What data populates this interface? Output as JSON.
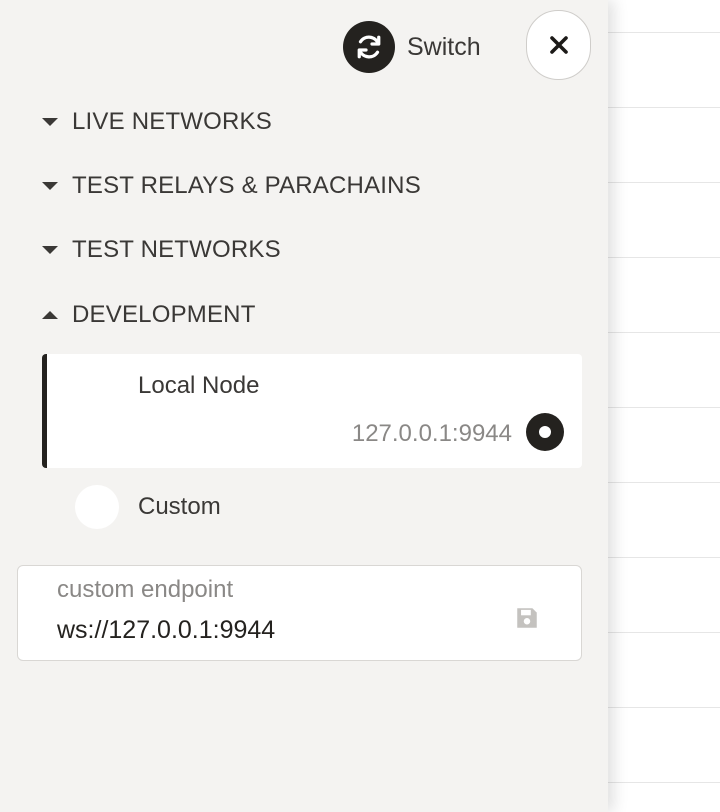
{
  "header": {
    "switch_label": "Switch",
    "switch_icon": "refresh-icon",
    "close_icon": "close-icon"
  },
  "groups": [
    {
      "label": "LIVE NETWORKS",
      "expanded": false
    },
    {
      "label": "TEST RELAYS & PARACHAINS",
      "expanded": false
    },
    {
      "label": "TEST NETWORKS",
      "expanded": false
    },
    {
      "label": "DEVELOPMENT",
      "expanded": true
    }
  ],
  "development": {
    "endpoints": [
      {
        "name": "Local Node",
        "url": "127.0.0.1:9944",
        "selected": true
      },
      {
        "name": "Custom",
        "selected": false
      }
    ]
  },
  "custom_endpoint": {
    "label": "custom endpoint",
    "value": "ws://127.0.0.1:9944",
    "save_icon": "save-icon"
  },
  "colors": {
    "panel_bg": "#f4f3f1",
    "accent_dark": "#24221f",
    "text": "#3a3836",
    "muted": "#8a8886"
  }
}
